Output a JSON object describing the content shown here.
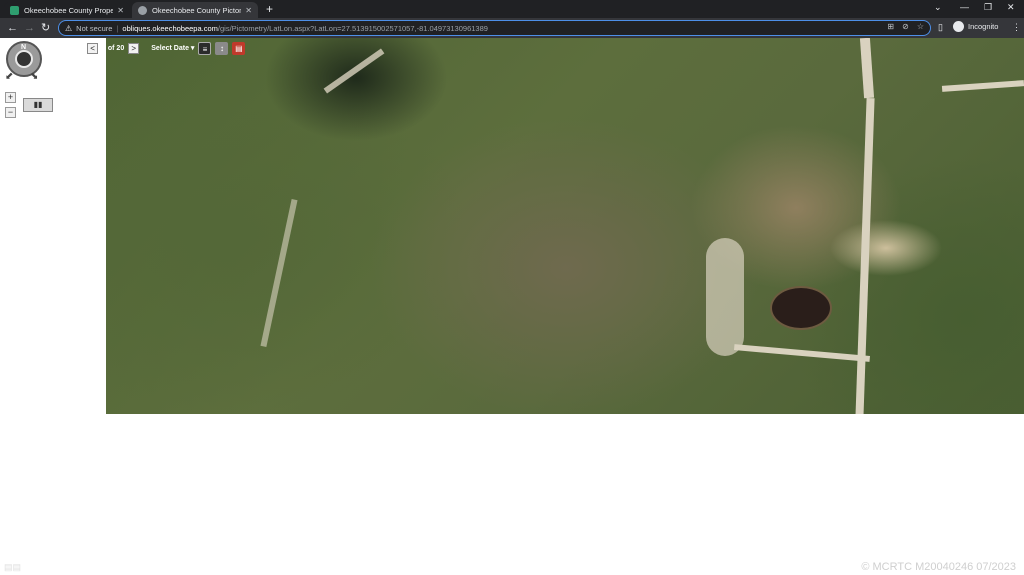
{
  "browser": {
    "tabs": [
      {
        "label": "Okeechobee County Property Ap",
        "favicon_color": "#2e9e6f"
      },
      {
        "label": "Okeechobee County Pictometry I",
        "favicon_color": "#9aa0a6"
      }
    ],
    "new_tab": "+",
    "window": {
      "minimize": "—",
      "restore": "❐",
      "close": "✕",
      "dropdown": "⌄"
    },
    "nav": {
      "back": "←",
      "forward": "→",
      "reload": "↻"
    },
    "address": {
      "warning_icon": "⚠",
      "not_secure": "Not secure",
      "separator": "|",
      "host": "obliques.okeechobeepa.com",
      "path": "/gis/Pictometry/LatLon.aspx?LatLon=27.513915002571057,-81.04973130961389"
    },
    "omni_icons": {
      "qr": "⊞",
      "hide": "⊘",
      "star": "☆"
    },
    "side_panel_icon": "▯",
    "profile": {
      "label": "Incognito"
    },
    "menu_icon": "⋮"
  },
  "map": {
    "date": "01/15/2023",
    "prev": "<",
    "position": "1 of 20",
    "next": ">",
    "select_date": "Select Date ▾",
    "compass_n": "N",
    "zoom_in": "+",
    "zoom_out": "−",
    "layers": "▮▮",
    "tools": {
      "layers": "≡",
      "measure": "↕",
      "export": "▤"
    }
  },
  "watermark": "© MCRTC M20040246 07/2023",
  "watermark_left": "▤▤"
}
